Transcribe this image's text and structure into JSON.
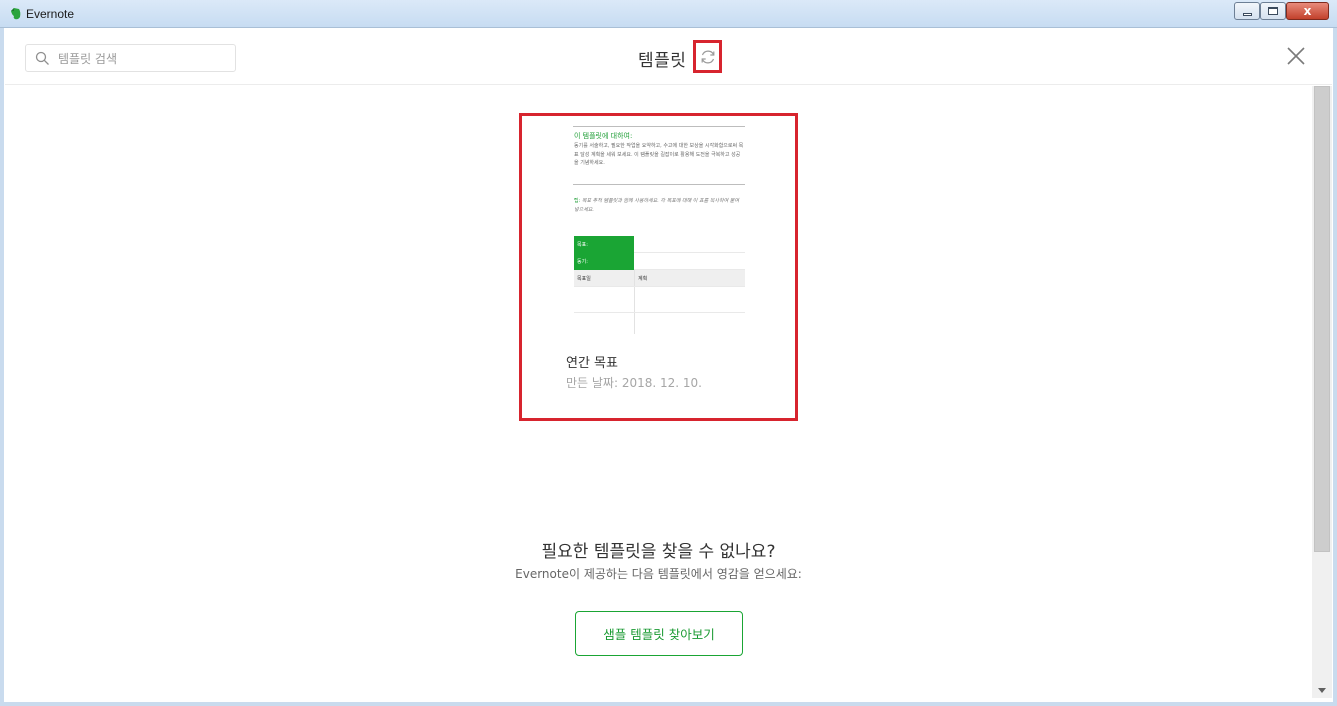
{
  "window": {
    "title": "Evernote",
    "close_glyph": "x"
  },
  "header": {
    "search_placeholder": "템플릿 검색",
    "title": "템플릿"
  },
  "template_card": {
    "preview": {
      "heading": "이 템플릿에 대하여:",
      "paragraph": "동기를 서술하고, 필요한 작업을 요약하고, 수고에 대한 보상을 시각화함으로써 목표 달성 계획을 세워 보세요. 이 템플릿을 길잡이로 활용해 도전을 극복하고 성공을 기념하세요.",
      "tip_label": "팁:",
      "tip_text": "목표 추적 템플릿과 함께 사용하세요. 각 목표에 대해 이 표를 복사하여 붙여 넣으세요.",
      "table_goal_label": "목표:",
      "table_motivation_label": "동기:",
      "table_col_date": "목표일",
      "table_col_plan": "계획"
    },
    "name": "연간 목표",
    "created_date": "만든 날짜: 2018. 12. 10."
  },
  "empty_prompt": {
    "title": "필요한 템플릿을 찾을 수 없나요?",
    "subtitle": "Evernote이 제공하는 다음 템플릿에서 영감을 얻으세요:",
    "button_label": "샘플 템플릿 찾아보기"
  },
  "colors": {
    "accent_green": "#1aa534",
    "highlight_red": "#d7242e"
  }
}
